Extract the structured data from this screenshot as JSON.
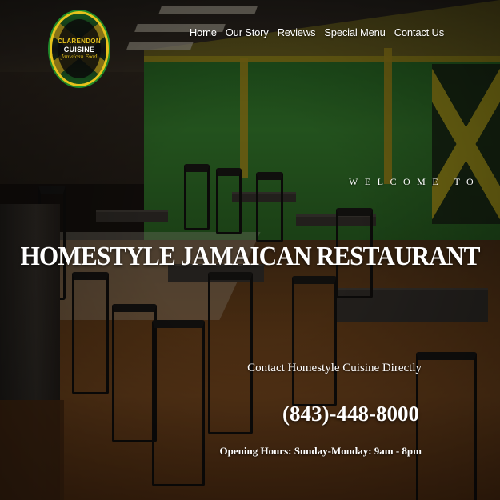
{
  "logo": {
    "line1": "CLARENDON",
    "line2": "CUISINE",
    "line3": "Jamaican Food"
  },
  "nav": {
    "items": [
      {
        "label": "Home"
      },
      {
        "label": "Our Story"
      },
      {
        "label": "Reviews"
      },
      {
        "label": "Special Menu"
      },
      {
        "label": "Contact Us"
      }
    ]
  },
  "hero": {
    "welcome": "WELCOME TO",
    "headline": "HOMESTYLE JAMAICAN RESTAURANT",
    "contact_line": "Contact Homestyle Cuisine Directly",
    "phone": "(843)-448-8000",
    "hours": "Opening Hours: Sunday-Monday: 9am - 8pm"
  },
  "colors": {
    "accent_yellow": "#e6c21c",
    "accent_green": "#1f8a2a",
    "text": "#ffffff"
  }
}
